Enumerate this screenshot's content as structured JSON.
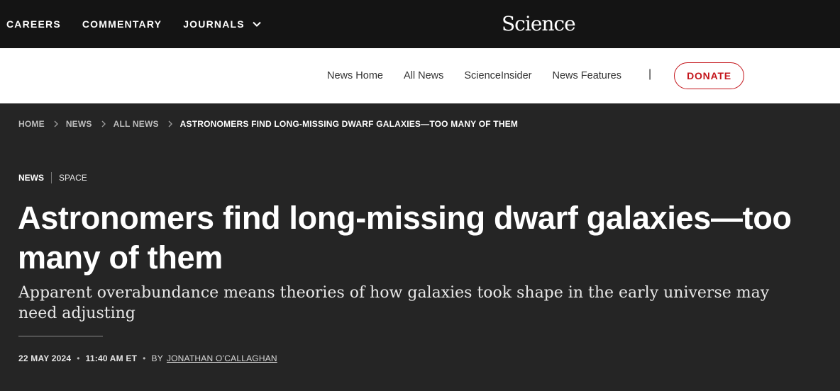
{
  "topbar": {
    "nav": [
      "CAREERS",
      "COMMENTARY",
      "JOURNALS"
    ],
    "logo": "Science"
  },
  "subnav": {
    "links": [
      "News Home",
      "All News",
      "ScienceInsider",
      "News Features"
    ],
    "separator": "|",
    "donate_label": "DONATE"
  },
  "breadcrumb": [
    "HOME",
    "NEWS",
    "ALL NEWS",
    "ASTRONOMERS FIND LONG-MISSING DWARF GALAXIES—TOO MANY OF THEM"
  ],
  "tags": {
    "primary": "NEWS",
    "secondary": "SPACE"
  },
  "article": {
    "headline": "Astronomers find long-missing dwarf galaxies—too many of them",
    "dek": "Apparent overabundance means theories of how galaxies took shape in the early universe may need adjusting",
    "date": "22 MAY 2024",
    "time": "11:40 AM ET",
    "by": "BY",
    "author": "JONATHAN O’CALLAGHAN",
    "dot": "•"
  },
  "colors": {
    "accent": "#c4161c",
    "topbar": "#141414",
    "hero": "#252525"
  }
}
